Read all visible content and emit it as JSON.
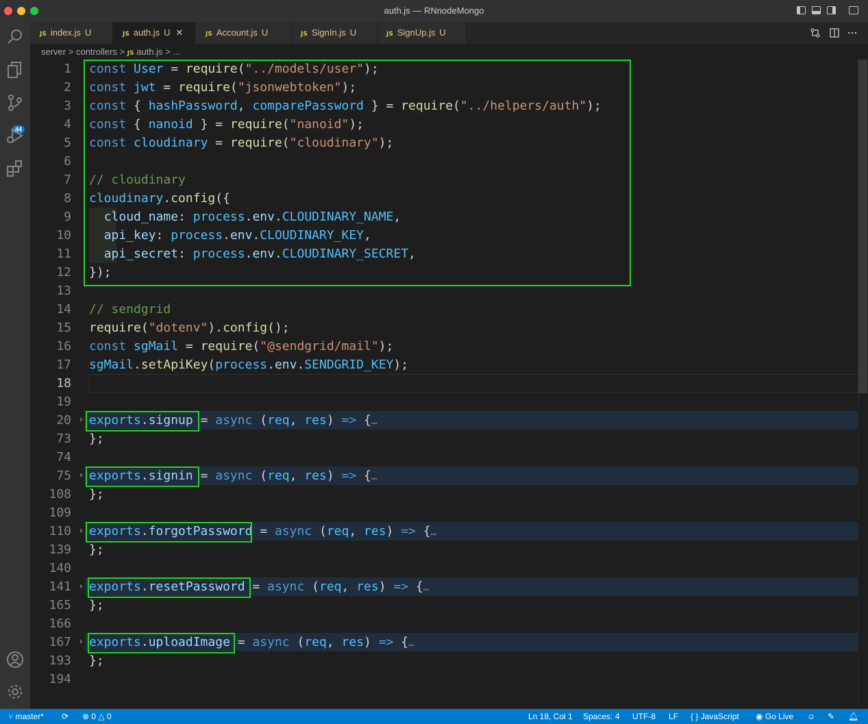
{
  "window": {
    "title": "auth.js — RNnodeMongo",
    "traffic_colors": [
      "#ff5f57",
      "#febc2e",
      "#28c840"
    ]
  },
  "activity_bar": {
    "items": [
      "search-icon",
      "files-icon",
      "source-control-icon",
      "run-debug-icon",
      "extensions-icon"
    ],
    "bottom_items": [
      "account-icon",
      "settings-gear-icon"
    ],
    "source_control_badge": "44"
  },
  "tabs": [
    {
      "icon": "JS",
      "label": "index.js",
      "status": "U"
    },
    {
      "icon": "JS",
      "label": "auth.js",
      "status": "U",
      "close": "✕"
    },
    {
      "icon": "JS",
      "label": "Account.js",
      "status": "U"
    },
    {
      "icon": "JS",
      "label": "SignIn.js",
      "status": "U"
    },
    {
      "icon": "JS",
      "label": "SignUp.js",
      "status": "U"
    }
  ],
  "breadcrumb": {
    "parts": [
      "server",
      "controllers",
      "auth.js",
      "..."
    ],
    "file_icon": "JS",
    "separator": ">"
  },
  "editor": {
    "cursor_line": "18",
    "lines": [
      {
        "num": "1",
        "text": "const User = require(\"../models/user\");"
      },
      {
        "num": "2",
        "text": "const jwt = require(\"jsonwebtoken\");"
      },
      {
        "num": "3",
        "text": "const { hashPassword, comparePassword } = require(\"../helpers/auth\");"
      },
      {
        "num": "4",
        "text": "const { nanoid } = require(\"nanoid\");"
      },
      {
        "num": "5",
        "text": "const cloudinary = require(\"cloudinary\");"
      },
      {
        "num": "6",
        "text": ""
      },
      {
        "num": "7",
        "text": "// cloudinary"
      },
      {
        "num": "8",
        "text": "cloudinary.config({"
      },
      {
        "num": "9",
        "text": "  cloud_name: process.env.CLOUDINARY_NAME,"
      },
      {
        "num": "10",
        "text": "  api_key: process.env.CLOUDINARY_KEY,"
      },
      {
        "num": "11",
        "text": "  api_secret: process.env.CLOUDINARY_SECRET,"
      },
      {
        "num": "12",
        "text": "});"
      },
      {
        "num": "13",
        "text": ""
      },
      {
        "num": "14",
        "text": "// sendgrid"
      },
      {
        "num": "15",
        "text": "require(\"dotenv\").config();"
      },
      {
        "num": "16",
        "text": "const sgMail = require(\"@sendgrid/mail\");"
      },
      {
        "num": "17",
        "text": "sgMail.setApiKey(process.env.SENDGRID_KEY);"
      },
      {
        "num": "18",
        "text": ""
      },
      {
        "num": "19",
        "text": ""
      },
      {
        "num": "20",
        "text": "exports.signup = async (req, res) => {…",
        "folded": true
      },
      {
        "num": "73",
        "text": "};"
      },
      {
        "num": "74",
        "text": ""
      },
      {
        "num": "75",
        "text": "exports.signin = async (req, res) => {…",
        "folded": true
      },
      {
        "num": "108",
        "text": "};"
      },
      {
        "num": "109",
        "text": ""
      },
      {
        "num": "110",
        "text": "exports.forgotPassword = async (req, res) => {…",
        "folded": true
      },
      {
        "num": "139",
        "text": "};"
      },
      {
        "num": "140",
        "text": ""
      },
      {
        "num": "141",
        "text": "exports.resetPassword = async (req, res) => {…",
        "folded": true
      },
      {
        "num": "165",
        "text": "};"
      },
      {
        "num": "166",
        "text": ""
      },
      {
        "num": "167",
        "text": "exports.uploadImage = async (req, res) => {…",
        "folded": true
      },
      {
        "num": "193",
        "text": "};"
      },
      {
        "num": "194",
        "text": ""
      }
    ]
  },
  "highlight_color": "#1fd61f",
  "status_bar": {
    "branch": "master*",
    "errors": "0",
    "warnings": "0",
    "position": "Ln 18, Col 1",
    "spaces": "Spaces: 4",
    "encoding": "UTF-8",
    "eol": "LF",
    "language": "JavaScript",
    "language_icon": "{ }",
    "go_live": "Go Live",
    "background": "#007acc"
  }
}
